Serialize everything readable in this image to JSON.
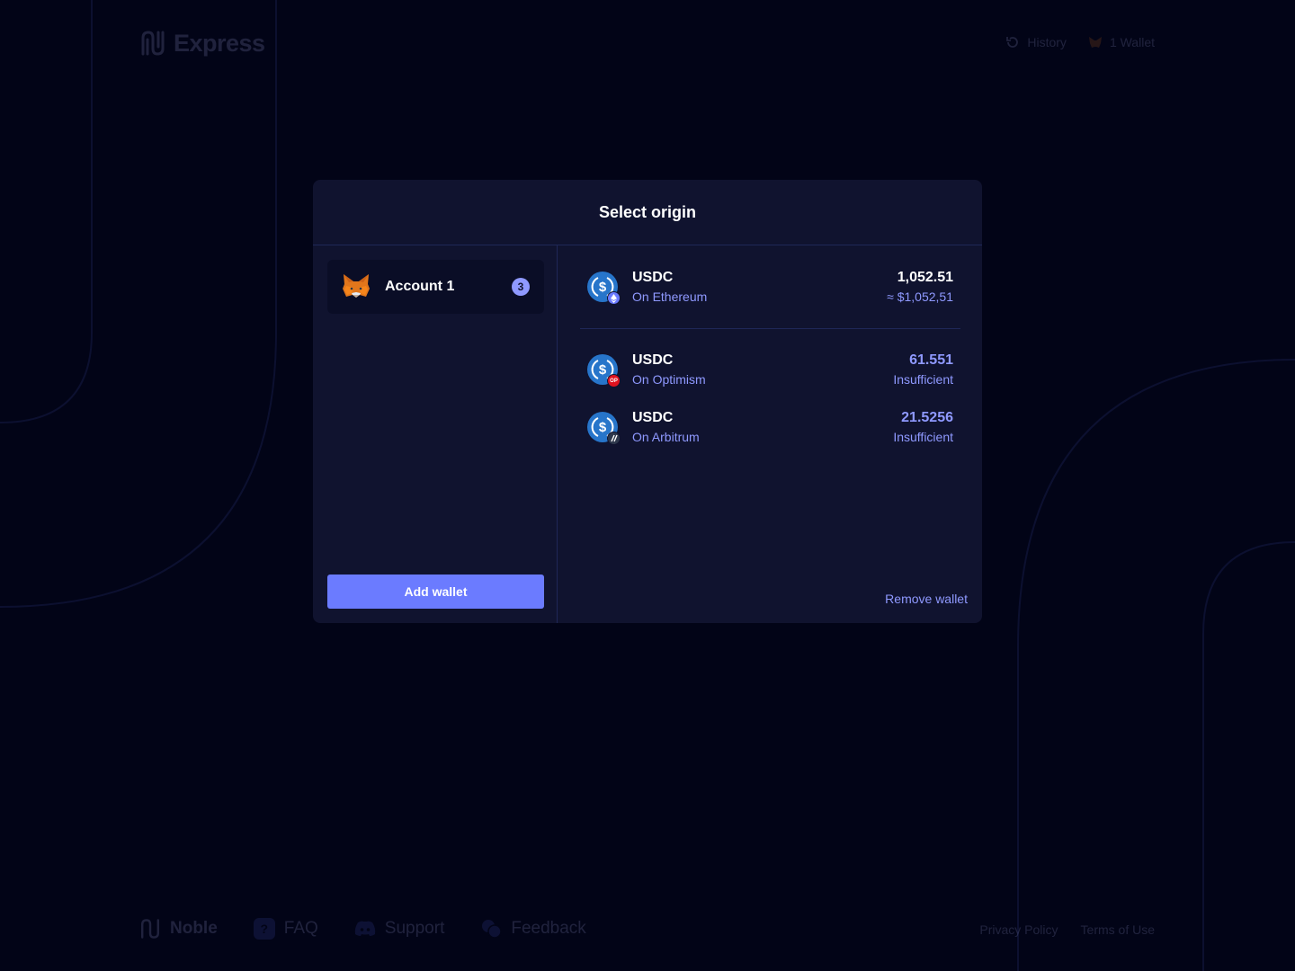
{
  "header": {
    "logo_text": "Express",
    "history_label": "History",
    "wallet_label": "1 Wallet"
  },
  "modal": {
    "title": "Select origin",
    "account": {
      "name": "Account 1",
      "count": "3"
    },
    "add_wallet_label": "Add wallet",
    "remove_wallet_label": "Remove wallet",
    "tokens": [
      {
        "symbol": "USDC",
        "chain": "On Ethereum",
        "amount": "1,052.51",
        "sub": "≈ $1,052,51",
        "chain_color": "#6b7bff"
      },
      {
        "symbol": "USDC",
        "chain": "On Optimism",
        "amount": "61.551",
        "sub": "Insufficient",
        "chain_color": "#e0121f"
      },
      {
        "symbol": "USDC",
        "chain": "On Arbitrum",
        "amount": "21.5256",
        "sub": "Insufficient",
        "chain_color": "#2d374b"
      }
    ]
  },
  "footer": {
    "brand": "Noble",
    "faq_label": "FAQ",
    "support_label": "Support",
    "feedback_label": "Feedback",
    "privacy_label": "Privacy Policy",
    "terms_label": "Terms of Use"
  },
  "colors": {
    "background": "#020417",
    "modal_bg": "#10132f",
    "accent": "#6b7bff",
    "muted_text": "#8f99ff",
    "usdc_blue": "#2775ca"
  }
}
